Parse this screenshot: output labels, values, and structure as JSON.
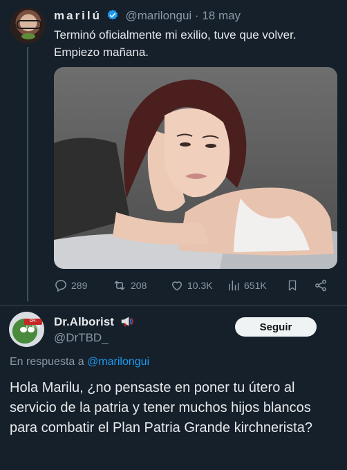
{
  "tweet": {
    "author_name": "marilú",
    "author_handle": "@marilongui",
    "date": "18 may",
    "text": "Terminó oficialmente mi exilio, tuve que volver. Empiezo mañana.",
    "photo_alt_icon": "photo-of-person-in-bed",
    "stats": {
      "replies": "289",
      "reposts": "208",
      "likes": "10.3K",
      "views": "651K"
    },
    "verified_color": "#1d9bf0"
  },
  "reply": {
    "author_name": "Dr.Alborist",
    "author_handle": "@DrTBD_",
    "follow_label": "Seguir",
    "reply_prefix": "En respuesta a",
    "reply_to_handle": "@marilongui",
    "text": "Hola Marilu, ¿no pensaste en poner tu útero al servicio de la patria y tener muchos hijos blancos para combatir el Plan Patria Grande kirchnerista?",
    "avatar_badge": "DR-KARDS"
  },
  "colors": {
    "background": "#15202b",
    "text": "#e7e9ea",
    "muted": "#8b98a5",
    "link": "#1d9bf0"
  }
}
